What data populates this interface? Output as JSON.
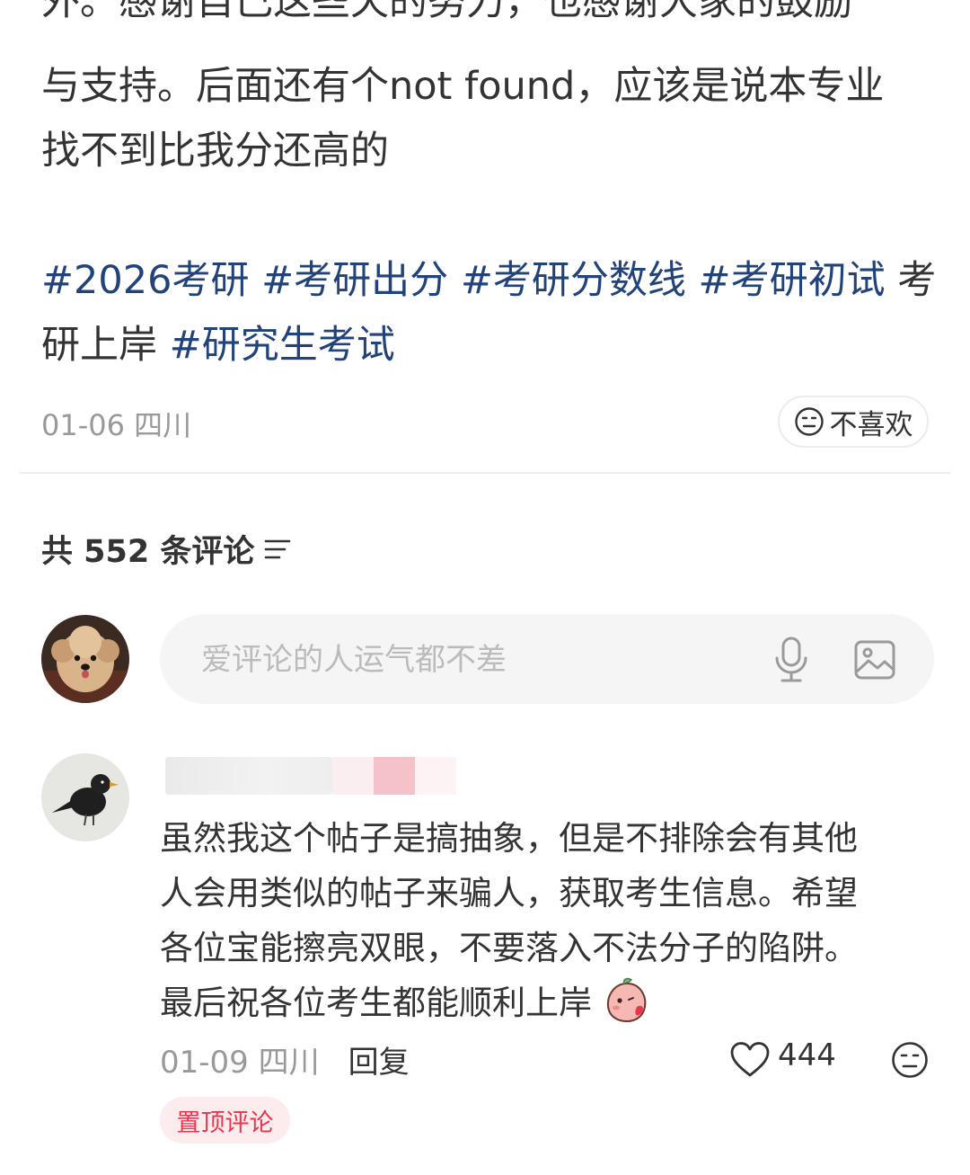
{
  "post": {
    "cut_line": "外。感谢自己这些天的努力，也感谢大家的鼓励",
    "line1": "与支持。后面还有个not found，应该是说本专业",
    "line2": "找不到比我分还高的",
    "tags_line1": [
      {
        "text": "#2026考研",
        "type": "tag"
      },
      {
        "text": "#考研出分",
        "type": "tag"
      },
      {
        "text": "#考研分数线",
        "type": "tag"
      },
      {
        "text": "#考研初试",
        "type": "tag"
      },
      {
        "text": "考",
        "type": "plain"
      }
    ],
    "tags_line2": [
      {
        "text": "研上岸",
        "type": "plain"
      },
      {
        "text": "#研究生考试",
        "type": "tag"
      }
    ],
    "meta": "01-06 四川",
    "dislike_label": "不喜欢"
  },
  "comments_header": {
    "count_label": "共 552 条评论",
    "sort_icon": "filter-lines-icon"
  },
  "input": {
    "placeholder": "爱评论的人运气都不差",
    "mic_icon": "microphone-icon",
    "image_icon": "image-icon"
  },
  "comment": {
    "lines": [
      "虽然我这个帖子是搞抽象，但是不排除会有其他",
      "人会用类似的帖子来骗人，获取考生信息。希望",
      "各位宝能擦亮双眼，不要落入不法分子的陷阱。",
      "最后祝各位考生都能顺利上岸"
    ],
    "date": "01-09 四川",
    "reply_label": "回复",
    "likes": "444",
    "pinned_label": "置顶评论"
  },
  "colors": {
    "tag": "#21437a",
    "text": "#333333",
    "muted": "#999999",
    "pin_bg": "#fdecee",
    "pin_text": "#e8364f"
  }
}
